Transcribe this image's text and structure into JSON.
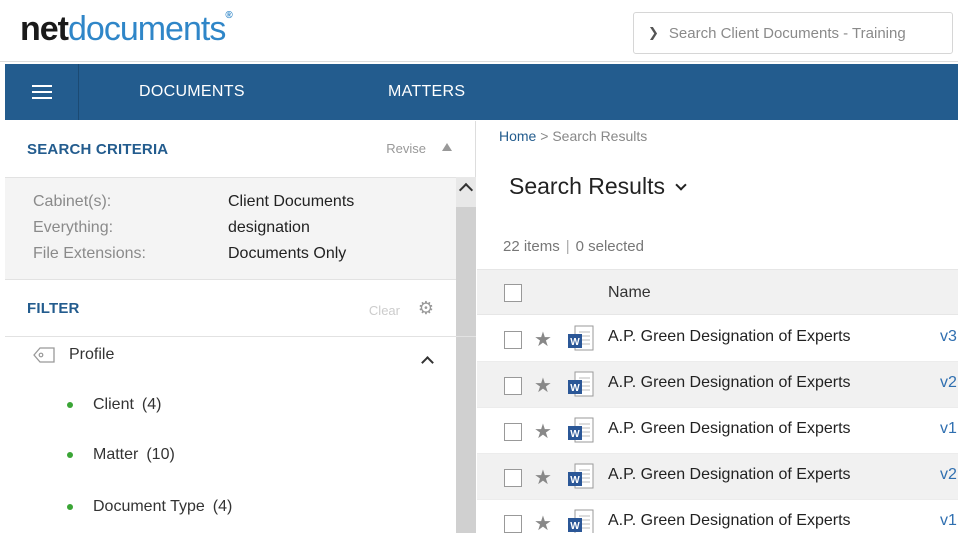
{
  "header": {
    "logo_net": "net",
    "logo_documents": "documents",
    "logo_reg": "®",
    "search_placeholder": "Search Client Documents - Training"
  },
  "nav": {
    "items": [
      {
        "label": "DOCUMENTS"
      },
      {
        "label": "MATTERS"
      }
    ]
  },
  "search_criteria": {
    "title": "SEARCH CRITERIA",
    "revise_label": "Revise",
    "rows": [
      {
        "key": "Cabinet(s):",
        "value": "Client Documents"
      },
      {
        "key": "Everything:",
        "value": "designation"
      },
      {
        "key": "File Extensions:",
        "value": "Documents Only"
      }
    ]
  },
  "filter": {
    "title": "FILTER",
    "clear_label": "Clear",
    "profile_label": "Profile",
    "items": [
      {
        "label": "Client",
        "count": "(4)"
      },
      {
        "label": "Matter",
        "count": "(10)"
      },
      {
        "label": "Document Type",
        "count": "(4)"
      }
    ]
  },
  "breadcrumb": {
    "home": "Home",
    "separator": ">",
    "current": "Search Results"
  },
  "results": {
    "title": "Search Results",
    "items_count": "22 items",
    "selected_count": "0 selected",
    "name_header": "Name",
    "rows": [
      {
        "name": "A.P. Green Designation of Experts",
        "version": "v3"
      },
      {
        "name": "A.P. Green Designation of Experts",
        "version": "v2"
      },
      {
        "name": "A.P. Green Designation of Experts",
        "version": "v1"
      },
      {
        "name": "A.P. Green Designation of Experts",
        "version": "v2"
      },
      {
        "name": "A.P. Green Designation of Experts",
        "version": "v1"
      }
    ]
  },
  "colors": {
    "nav_bg": "#235c8e",
    "accent": "#2f86c8",
    "filter_dot": "#3aa536"
  }
}
